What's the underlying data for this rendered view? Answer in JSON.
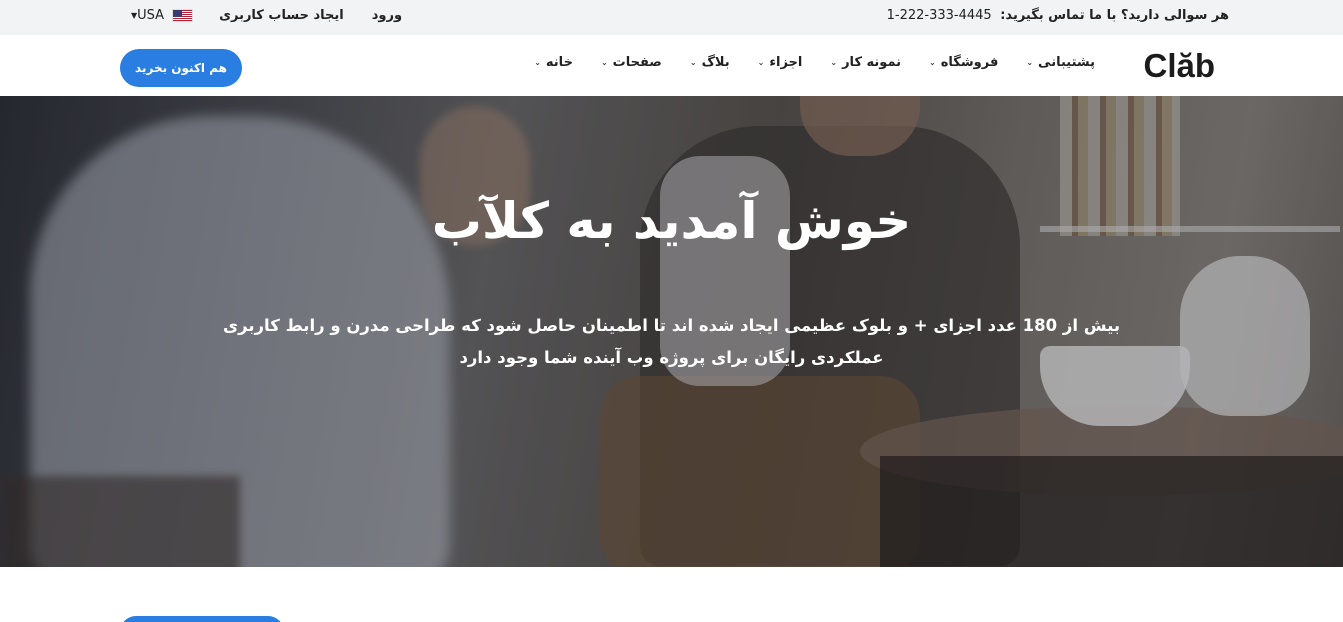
{
  "topbar": {
    "contact_label": "هر سوالی دارید؟ با ما تماس بگیرید:",
    "phone": "1-222-333-4445",
    "currency": "USA",
    "login": "ورود",
    "register": "ایجاد حساب کاربری"
  },
  "header": {
    "logo": "Clăb",
    "nav": [
      {
        "label": "خانه"
      },
      {
        "label": "صفحات"
      },
      {
        "label": "بلاگ"
      },
      {
        "label": "اجزاء"
      },
      {
        "label": "نمونه کار"
      },
      {
        "label": "فروشگاه"
      },
      {
        "label": "پشتیبانی"
      }
    ],
    "buy_button": "هم اکنون بخرید"
  },
  "hero": {
    "title": "خوش آمدید به کلآب",
    "text": "بیش از 180 عدد اجزای + و بلوک عظیمی ایجاد شده اند تا اطمینان حاصل شود که طراحی مدرن و رابط کاربری عملکردی رایگان برای پروژه وب آینده شما وجود دارد"
  },
  "colors": {
    "accent": "#2a7de1",
    "topbar_bg": "#f2f3f5"
  }
}
